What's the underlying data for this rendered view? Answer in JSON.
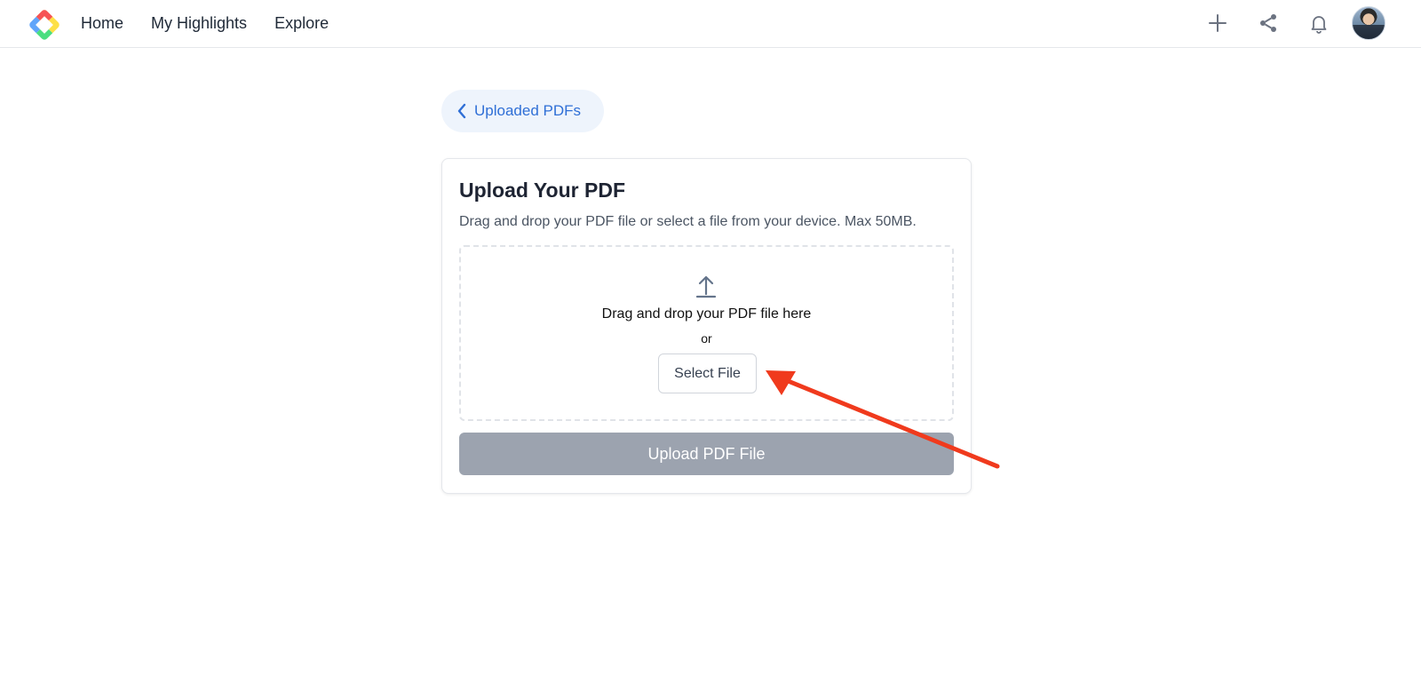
{
  "nav": {
    "items": [
      {
        "label": "Home"
      },
      {
        "label": "My Highlights"
      },
      {
        "label": "Explore"
      }
    ]
  },
  "top_actions": {
    "icons": [
      "plus-icon",
      "share-icon",
      "bell-icon"
    ],
    "avatar": "user-avatar"
  },
  "back_link": {
    "label": "Uploaded PDFs",
    "icon": "chevron-left-icon"
  },
  "upload_card": {
    "title": "Upload Your PDF",
    "description": "Drag and drop your PDF file or select a file from your device. Max 50MB.",
    "dropzone": {
      "icon": "upload-icon",
      "text": "Drag and drop your PDF file here",
      "or_text": "or",
      "select_label": "Select File"
    },
    "upload_label": "Upload PDF File"
  },
  "colors": {
    "accent": "#2f6fd6",
    "pill_bg": "#eef4fc",
    "upload_disabled": "#9ca3af",
    "annotation_arrow": "#f03a1d"
  }
}
